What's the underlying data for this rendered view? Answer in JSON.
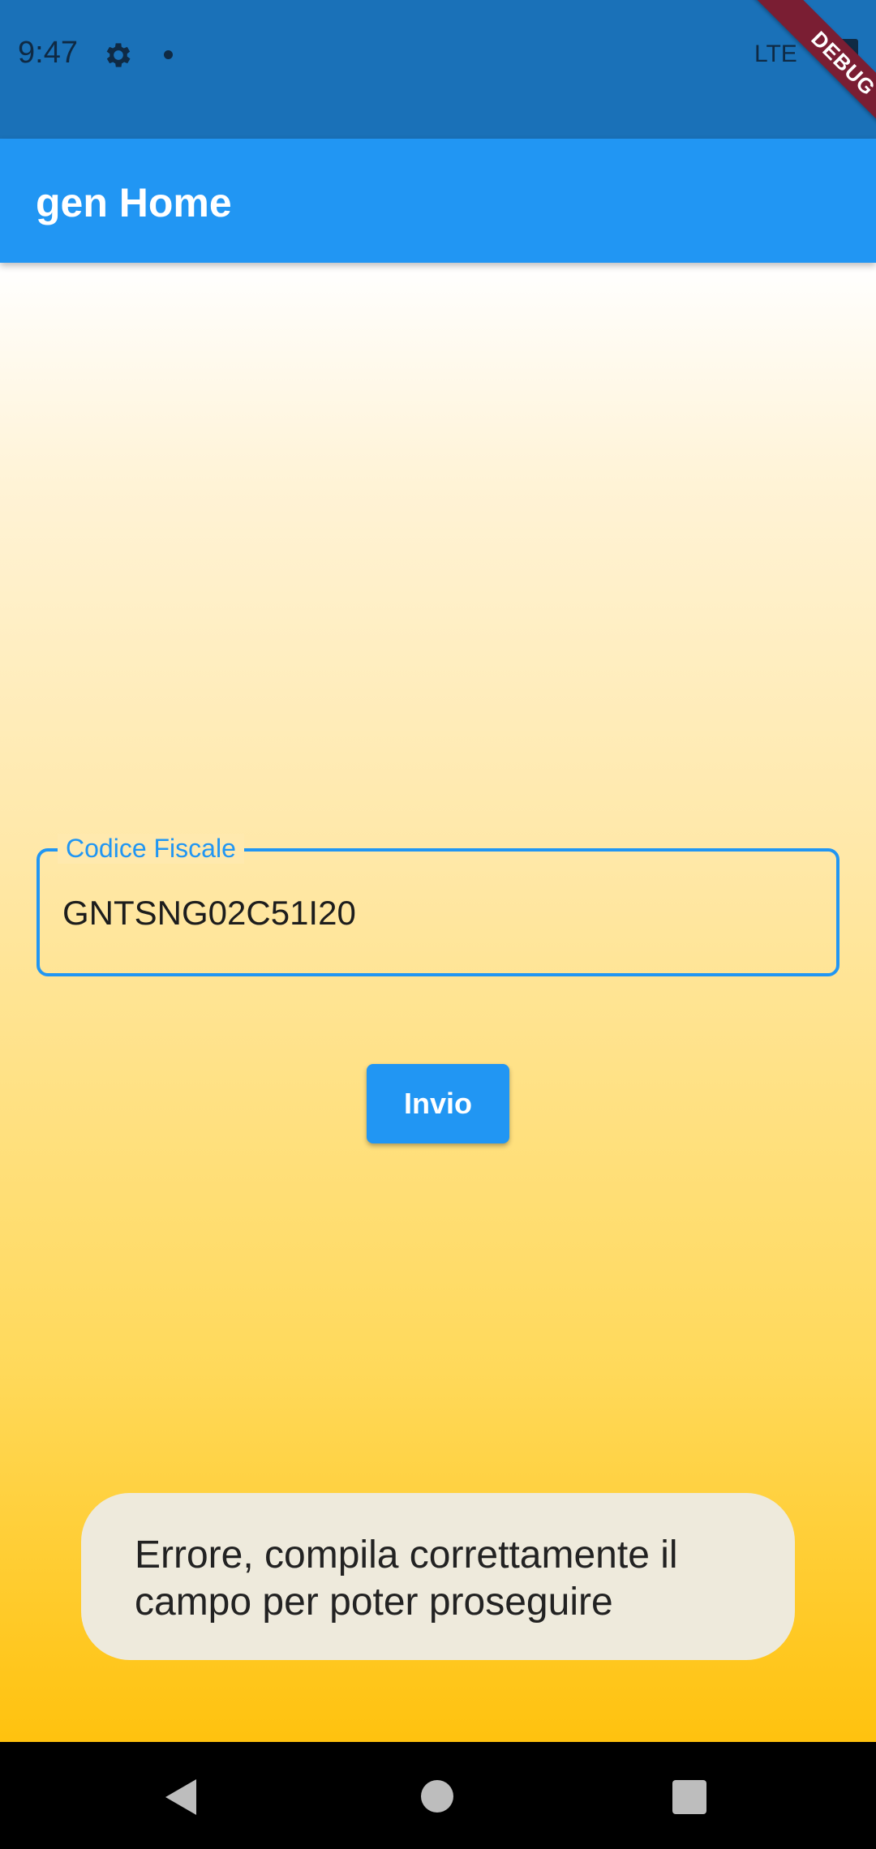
{
  "status_bar": {
    "time": "9:47",
    "network": "LTE",
    "icons": [
      "gear-icon",
      "dot-icon",
      "battery-icon"
    ]
  },
  "debug_banner": "DEBUG",
  "app_bar": {
    "title": "gen Home"
  },
  "form": {
    "field_label": "Codice Fiscale",
    "field_value": "GNTSNG02C51I20",
    "submit_label": "Invio"
  },
  "snackbar": {
    "message_line1": "Errore, compila correttamente il",
    "message_line2": "campo per poter proseguire"
  },
  "nav_bar": {
    "icons": [
      "back-icon",
      "home-icon",
      "recent-apps-icon"
    ]
  },
  "colors": {
    "app_bar": "#2196f3",
    "status_bar": "#1a71b8",
    "accent": "#2196f3",
    "gradient_end": "#ffc20e"
  }
}
